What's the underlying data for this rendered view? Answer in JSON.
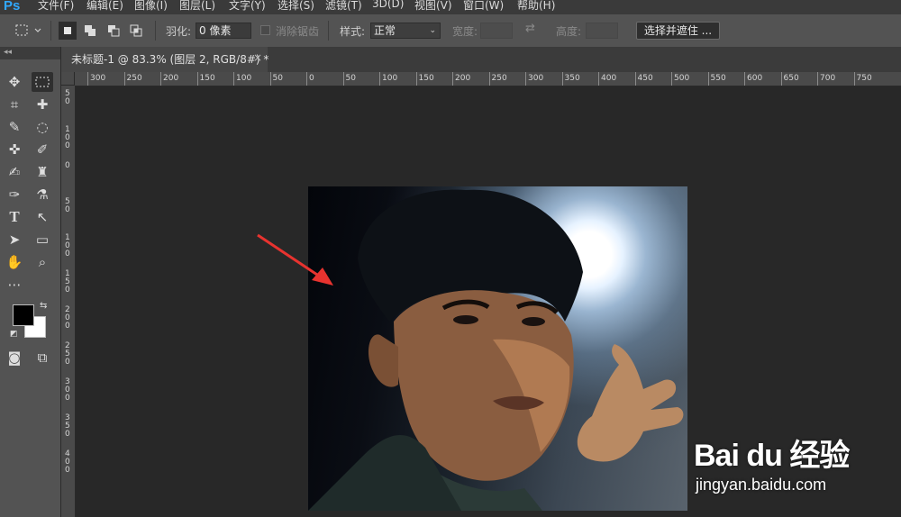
{
  "app": {
    "logo": "Ps"
  },
  "menu": [
    "文件(F)",
    "编辑(E)",
    "图像(I)",
    "图层(L)",
    "文字(Y)",
    "选择(S)",
    "滤镜(T)",
    "3D(D)",
    "视图(V)",
    "窗口(W)",
    "帮助(H)"
  ],
  "options": {
    "feather_label": "羽化:",
    "feather_value": "0 像素",
    "antialias_label": "消除锯齿",
    "style_label": "样式:",
    "style_value": "正常",
    "width_label": "宽度:",
    "height_label": "高度:",
    "select_mask_button": "选择并遮住 ..."
  },
  "document": {
    "tab_title": "未标题-1 @ 83.3% (图层 2, RGB/8#) *",
    "close": "×"
  },
  "ruler": {
    "h_labels": [
      "300",
      "250",
      "200",
      "150",
      "100",
      "50",
      "0",
      "50",
      "100",
      "150",
      "200",
      "250",
      "300",
      "350",
      "400",
      "450",
      "500",
      "550",
      "600",
      "650",
      "700",
      "750"
    ],
    "v_labels": [
      "50",
      "100",
      "0",
      "50",
      "100",
      "150",
      "200",
      "250",
      "300",
      "350",
      "400"
    ]
  },
  "tools": {
    "left_icons": [
      "move-icon",
      "crop-icon",
      "quick-select-icon",
      "spot-healing-icon",
      "brush-icon",
      "eraser-icon",
      "type-icon",
      "path-select-icon",
      "hand-icon",
      "more-tools-icon"
    ],
    "right_icons": [
      "rect-marquee-icon",
      "healing-brush-icon",
      "lasso-icon",
      "eyedropper-icon",
      "stamp-icon",
      "paint-bucket-icon",
      "direct-select-icon",
      "rectangle-shape-icon",
      "zoom-icon"
    ],
    "foreground_color": "#000000",
    "background_color": "#ffffff"
  },
  "watermark": {
    "logo": "Bai du 经验",
    "url": "jingyan.baidu.com"
  },
  "colors": {
    "accent": "#31a8ff",
    "arrow": "#e8332f"
  }
}
